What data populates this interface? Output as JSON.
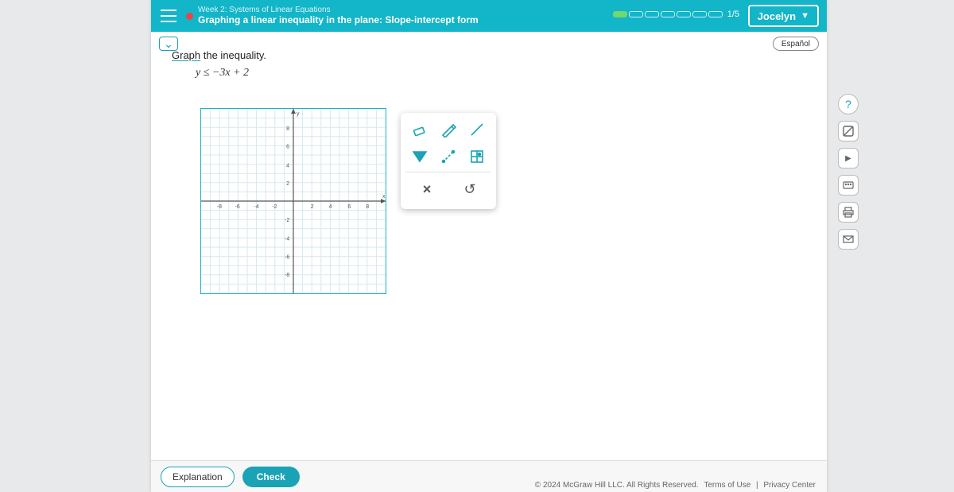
{
  "header": {
    "breadcrumb": "Week 2: Systems of Linear Equations",
    "title": "Graphing a linear inequality in the plane: Slope-intercept form",
    "progress_text": "1/5",
    "user_name": "Jocelyn"
  },
  "lang_button": "Español",
  "instruction_verb": "Graph",
  "instruction_rest": " the inequality.",
  "formula": "y ≤ −3x + 2",
  "graph": {
    "x_label": "x",
    "y_label": "y",
    "ticks": [
      "-8",
      "-6",
      "-4",
      "-2",
      "2",
      "4",
      "6",
      "8"
    ]
  },
  "tools": {
    "eraser": "eraser-icon",
    "pencil": "pencil-icon",
    "line": "line-icon",
    "flag": "fill-region-icon",
    "dashed": "dashed-line-icon",
    "point": "point-grid-icon",
    "clear": "×",
    "undo": "↺"
  },
  "side": {
    "help": "?",
    "calc": "calculator-icon",
    "video": "▶",
    "keyboard": "keyboard-icon",
    "print": "print-icon",
    "mail": "mail-icon"
  },
  "footer": {
    "explanation": "Explanation",
    "check": "Check"
  },
  "legal": {
    "copyright": "© 2024 McGraw Hill LLC. All Rights Reserved.",
    "terms": "Terms of Use",
    "privacy": "Privacy Center"
  },
  "progress_segments": 7,
  "progress_done": 1
}
